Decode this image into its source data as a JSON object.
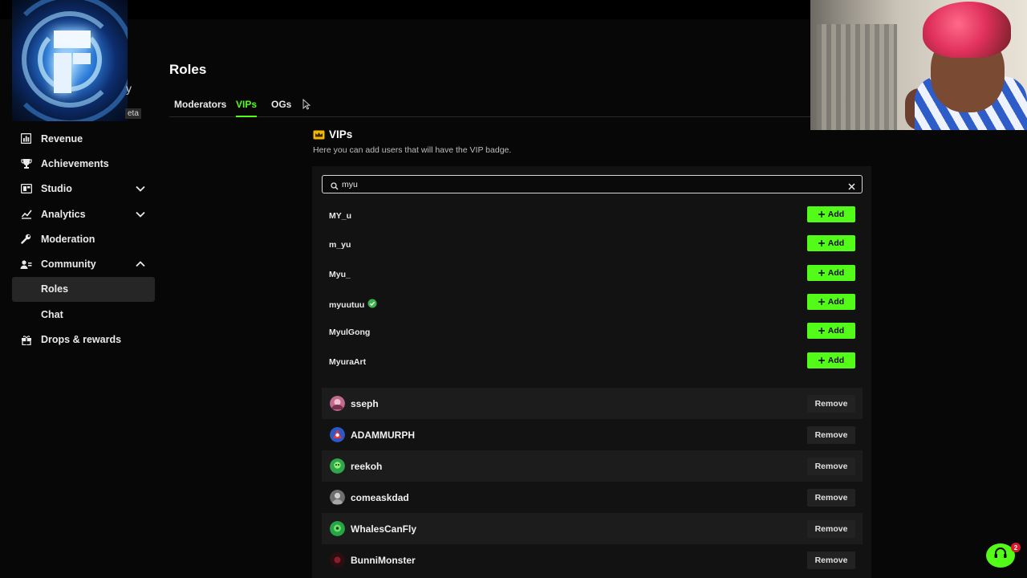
{
  "sidebar": {
    "beta_badge": "eta",
    "glyph": "y",
    "items": [
      {
        "label": "Revenue",
        "icon": "revenue-icon"
      },
      {
        "label": "Achievements",
        "icon": "trophy-icon"
      },
      {
        "label": "Studio",
        "icon": "studio-icon",
        "expandable": true
      },
      {
        "label": "Analytics",
        "icon": "analytics-icon",
        "expandable": true
      },
      {
        "label": "Moderation",
        "icon": "wrench-icon"
      },
      {
        "label": "Community",
        "icon": "community-icon",
        "expanded": true
      },
      {
        "label": "Roles",
        "sub": true,
        "active": true
      },
      {
        "label": "Chat",
        "sub": true
      },
      {
        "label": "Drops & rewards",
        "icon": "gift-icon"
      }
    ]
  },
  "page": {
    "title": "Roles",
    "tabs": [
      {
        "label": "Moderators",
        "active": false
      },
      {
        "label": "VIPs",
        "active": true
      },
      {
        "label": "OGs",
        "active": false
      }
    ]
  },
  "section": {
    "title": "VIPs",
    "description": "Here you can add users that will have the VIP badge."
  },
  "search": {
    "value": "myu"
  },
  "results": [
    {
      "username": "MY_u",
      "verified": false,
      "action": "Add"
    },
    {
      "username": "m_yu",
      "verified": false,
      "action": "Add"
    },
    {
      "username": "Myu_",
      "verified": false,
      "action": "Add"
    },
    {
      "username": "myuutuu",
      "verified": true,
      "action": "Add"
    },
    {
      "username": "MyulGong",
      "verified": false,
      "action": "Add"
    },
    {
      "username": "MyuraArt",
      "verified": false,
      "action": "Add"
    }
  ],
  "vips": [
    {
      "username": "sseph",
      "action": "Remove"
    },
    {
      "username": "ADAMMURPH",
      "action": "Remove"
    },
    {
      "username": "reekoh",
      "action": "Remove"
    },
    {
      "username": "comeaskdad",
      "action": "Remove"
    },
    {
      "username": "WhalesCanFly",
      "action": "Remove"
    },
    {
      "username": "BunniMonster",
      "action": "Remove"
    }
  ],
  "support": {
    "badge_count": "2"
  },
  "colors": {
    "accent": "#53fc18",
    "background": "#070707",
    "card": "#121212",
    "row_shaded": "#1c1c1c"
  }
}
